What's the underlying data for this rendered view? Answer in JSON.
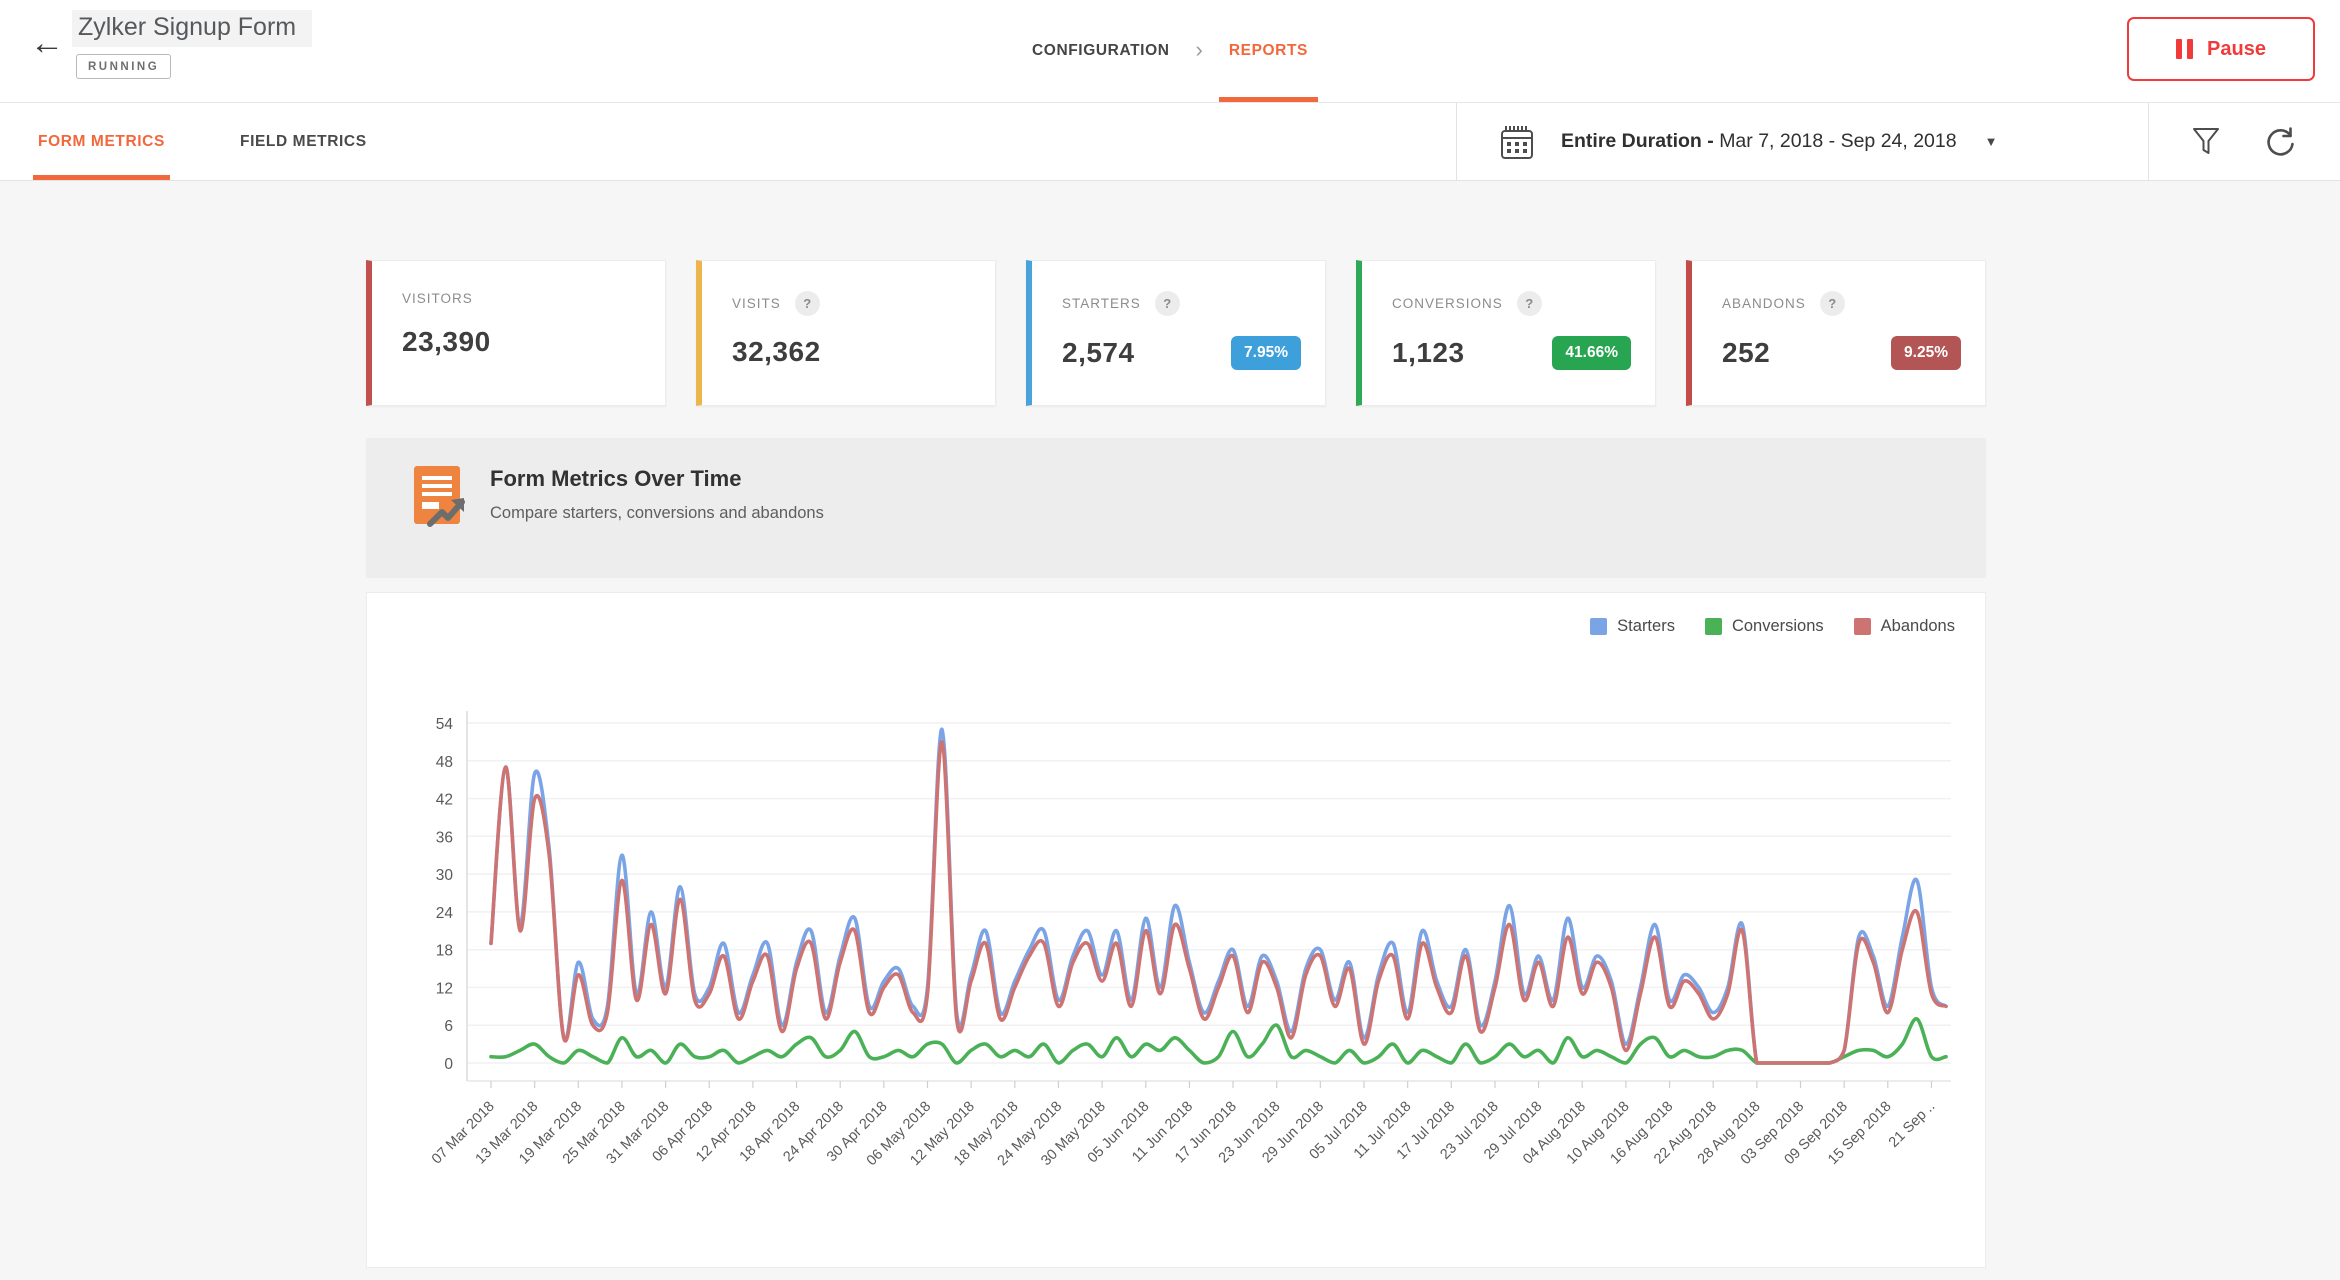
{
  "header": {
    "title": "Zylker Signup Form",
    "status": "RUNNING",
    "breadcrumb": {
      "configuration": "CONFIGURATION",
      "reports": "REPORTS"
    },
    "pause_label": "Pause"
  },
  "tabs": {
    "form_metrics": "FORM METRICS",
    "field_metrics": "FIELD METRICS"
  },
  "toolbar": {
    "date_label_bold": "Entire Duration -",
    "date_label_range": "Mar 7, 2018 - Sep 24, 2018"
  },
  "cards": [
    {
      "label": "VISITORS",
      "value": "23,390",
      "accent": "#c2504e",
      "help": false
    },
    {
      "label": "VISITS",
      "value": "32,362",
      "accent": "#edb54d",
      "help": true
    },
    {
      "label": "STARTERS",
      "value": "2,574",
      "accent": "#4aa2db",
      "help": true,
      "badge": "7.95%",
      "badge_color": "#3ea0db"
    },
    {
      "label": "CONVERSIONS",
      "value": "1,123",
      "accent": "#2fa956",
      "help": true,
      "badge": "41.66%",
      "badge_color": "#27a551"
    },
    {
      "label": "ABANDONS",
      "value": "252",
      "accent": "#c14c4a",
      "help": true,
      "badge": "9.25%",
      "badge_color": "#b45555"
    }
  ],
  "section": {
    "title": "Form Metrics Over Time",
    "subtitle": "Compare starters, conversions and abandons"
  },
  "chart_data": {
    "type": "line",
    "title": "Form Metrics Over Time",
    "x_start": "07 Mar 2018",
    "x_end": "24 Sep 2018",
    "point_interval_days": 2,
    "ylim": [
      0,
      54
    ],
    "grid": true,
    "legend_position": "top-right",
    "y_ticks": [
      0,
      6,
      12,
      18,
      24,
      30,
      36,
      42,
      48,
      54
    ],
    "x_tick_labels": [
      "07 Mar 2018",
      "13 Mar 2018",
      "19 Mar 2018",
      "25 Mar 2018",
      "31 Mar 2018",
      "06 Apr 2018",
      "12 Apr 2018",
      "18 Apr 2018",
      "24 Apr 2018",
      "30 Apr 2018",
      "06 May 2018",
      "12 May 2018",
      "18 May 2018",
      "24 May 2018",
      "30 May 2018",
      "05 Jun 2018",
      "11 Jun 2018",
      "17 Jun 2018",
      "23 Jun 2018",
      "29 Jun 2018",
      "05 Jul 2018",
      "11 Jul 2018",
      "17 Jul 2018",
      "23 Jul 2018",
      "29 Jul 2018",
      "04 Aug 2018",
      "10 Aug 2018",
      "16 Aug 2018",
      "22 Aug 2018",
      "28 Aug 2018",
      "03 Sep 2018",
      "09 Sep 2018",
      "15 Sep 2018",
      "21 Sep .."
    ],
    "series": [
      {
        "name": "Starters",
        "color": "#7aa4e6",
        "values": [
          19,
          47,
          22,
          46,
          34,
          4,
          16,
          7,
          9,
          33,
          11,
          24,
          12,
          28,
          11,
          12,
          19,
          8,
          14,
          19,
          6,
          16,
          21,
          8,
          17,
          23,
          9,
          13,
          15,
          9,
          12,
          53,
          8,
          14,
          21,
          8,
          13,
          18,
          21,
          10,
          17,
          21,
          14,
          21,
          10,
          23,
          12,
          25,
          16,
          8,
          13,
          18,
          9,
          17,
          13,
          5,
          15,
          18,
          10,
          16,
          4,
          14,
          19,
          8,
          21,
          13,
          9,
          18,
          6,
          13,
          25,
          11,
          17,
          10,
          23,
          12,
          17,
          13,
          3,
          12,
          22,
          10,
          14,
          12,
          8,
          12,
          22,
          0,
          0,
          0,
          0,
          0,
          0,
          2,
          20,
          17,
          9,
          20,
          29,
          12,
          9
        ]
      },
      {
        "name": "Conversions",
        "color": "#4bb157",
        "values": [
          1,
          1,
          2,
          3,
          1,
          0,
          2,
          1,
          0,
          4,
          1,
          2,
          0,
          3,
          1,
          1,
          2,
          0,
          1,
          2,
          1,
          3,
          4,
          1,
          2,
          5,
          1,
          1,
          2,
          1,
          3,
          3,
          0,
          2,
          3,
          1,
          2,
          1,
          3,
          0,
          2,
          3,
          1,
          4,
          1,
          3,
          2,
          4,
          2,
          0,
          1,
          5,
          1,
          3,
          6,
          1,
          2,
          1,
          0,
          2,
          0,
          1,
          3,
          0,
          2,
          1,
          0,
          3,
          0,
          1,
          3,
          1,
          2,
          0,
          4,
          1,
          2,
          1,
          0,
          3,
          4,
          1,
          2,
          1,
          1,
          2,
          2,
          0,
          0,
          0,
          0,
          0,
          0,
          1,
          2,
          2,
          1,
          3,
          7,
          1,
          1
        ]
      },
      {
        "name": "Abandons",
        "color": "#cd7372",
        "values": [
          19,
          47,
          21,
          42,
          33,
          4,
          14,
          6,
          8,
          29,
          10,
          22,
          11,
          26,
          10,
          11,
          17,
          7,
          13,
          17,
          5,
          15,
          19,
          7,
          16,
          21,
          8,
          12,
          14,
          8,
          11,
          51,
          7,
          13,
          19,
          7,
          12,
          17,
          19,
          9,
          16,
          19,
          13,
          19,
          9,
          21,
          11,
          22,
          15,
          7,
          12,
          17,
          8,
          16,
          12,
          4,
          14,
          17,
          9,
          15,
          3,
          13,
          17,
          7,
          19,
          12,
          8,
          17,
          5,
          12,
          22,
          10,
          16,
          9,
          20,
          11,
          16,
          12,
          2,
          11,
          20,
          9,
          13,
          11,
          7,
          11,
          21,
          0,
          0,
          0,
          0,
          0,
          0,
          2,
          19,
          16,
          8,
          18,
          24,
          11,
          9
        ]
      }
    ]
  }
}
